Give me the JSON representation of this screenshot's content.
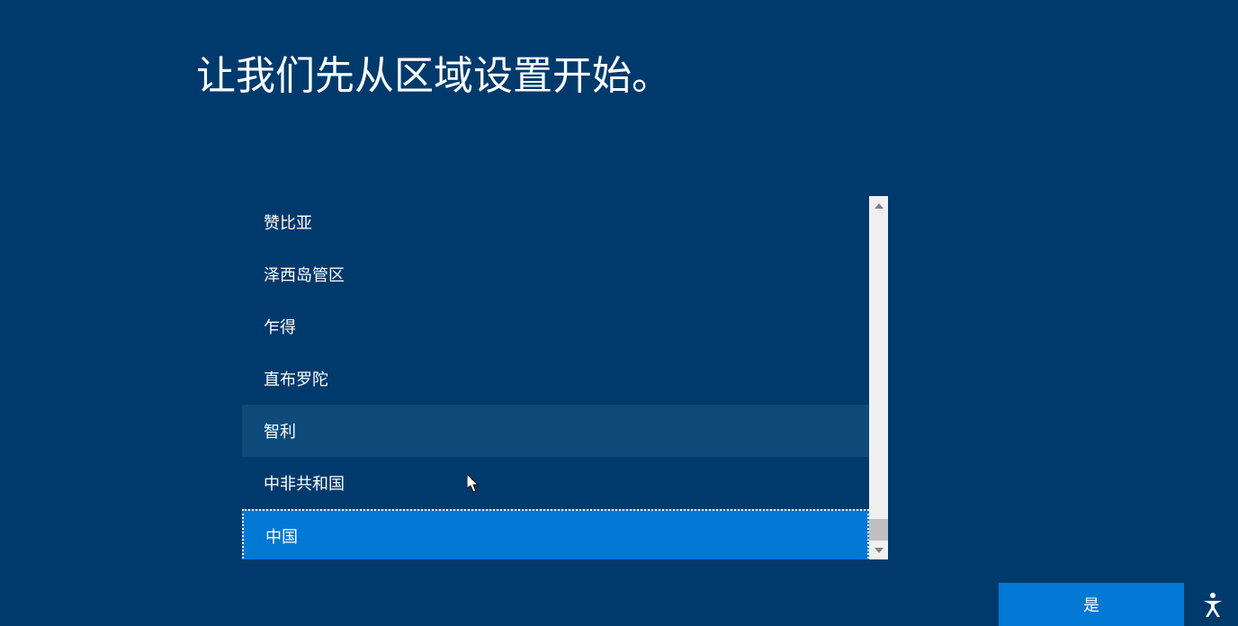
{
  "heading": "让我们先从区域设置开始。",
  "regions": {
    "items": [
      {
        "label": "赞比亚",
        "state": "normal"
      },
      {
        "label": "泽西岛管区",
        "state": "normal"
      },
      {
        "label": "乍得",
        "state": "normal"
      },
      {
        "label": "直布罗陀",
        "state": "normal"
      },
      {
        "label": "智利",
        "state": "hover"
      },
      {
        "label": "中非共和国",
        "state": "normal"
      },
      {
        "label": "中国",
        "state": "selected"
      }
    ]
  },
  "confirm_button": {
    "label": "是"
  }
}
